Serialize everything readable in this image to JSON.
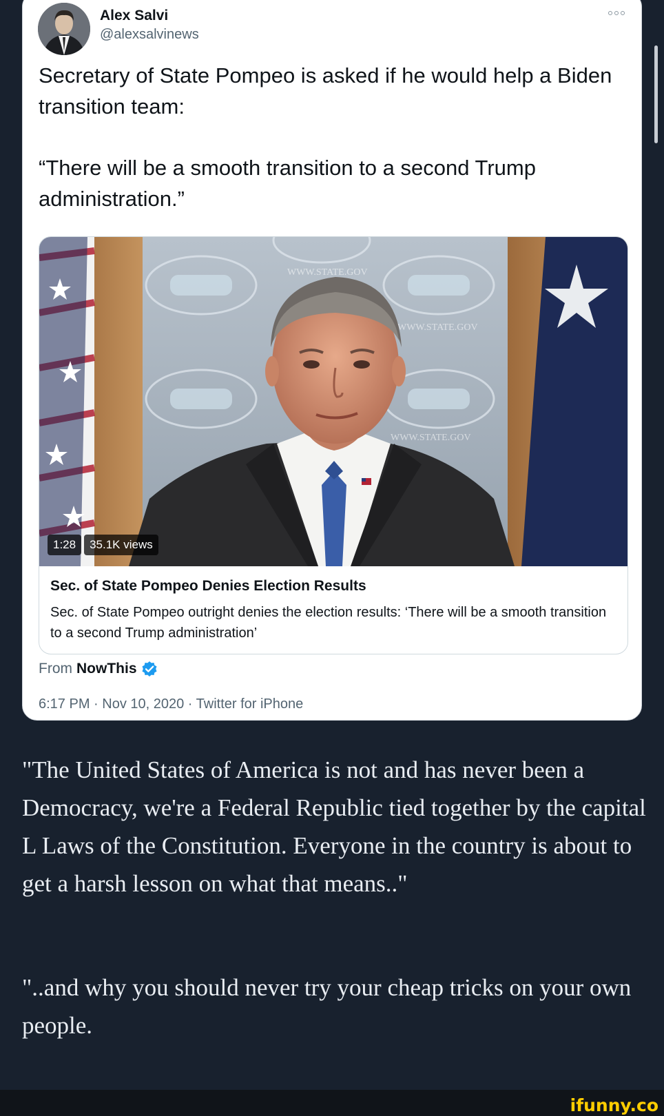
{
  "tweet": {
    "author_name": "Alex Salvi",
    "author_handle": "@alexsalvinews",
    "text_lines": [
      "Secretary of State Pompeo is asked if he would help a Biden transition team:",
      "“There will be a smooth transition to a second Trump administration.”"
    ],
    "media": {
      "duration": "1:28",
      "views": "35.1K views",
      "backdrop_text": "WWW.STATE.GOV"
    },
    "card": {
      "title": "Sec. of State Pompeo Denies Election Results",
      "description": "Sec. of State Pompeo outright denies the election results: ‘There will be a smooth transition to a second Trump administration’"
    },
    "from": {
      "prefix": "From",
      "source": "NowThis"
    },
    "meta": "6:17 PM · Nov 10, 2020 · Twitter for iPhone"
  },
  "comments": [
    "\"The United States of America is not and has never been a Democracy, we're a Federal Republic tied together by the capital L Laws of the Constitution. Everyone in the country is about to get a harsh lesson on what that means..\"",
    "\"..and why you should never try your cheap tricks on your own people."
  ],
  "watermark": "ifunny.co",
  "colors": {
    "page_bg": "#18212e",
    "card_bg": "#ffffff",
    "verified": "#1d9bf0",
    "watermark": "#ffcd00"
  }
}
